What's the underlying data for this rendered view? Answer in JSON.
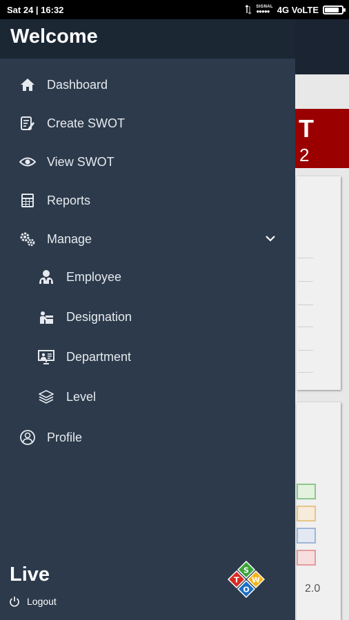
{
  "status_bar": {
    "time": "Sat 24 | 16:32",
    "signal_label": "SIGNAL",
    "network": "4G VoLTE",
    "battery_level": 0.85
  },
  "drawer": {
    "header_title": "Welcome",
    "menu": [
      {
        "label": "Dashboard",
        "icon": "home-icon"
      },
      {
        "label": "Create SWOT",
        "icon": "edit-document-icon"
      },
      {
        "label": "View SWOT",
        "icon": "eye-icon"
      },
      {
        "label": "Reports",
        "icon": "calculator-icon"
      },
      {
        "label": "Manage",
        "icon": "gears-icon",
        "expanded": true
      }
    ],
    "submenu": [
      {
        "label": "Employee",
        "icon": "users-icon"
      },
      {
        "label": "Designation",
        "icon": "worker-desk-icon"
      },
      {
        "label": "Department",
        "icon": "presentation-board-icon"
      },
      {
        "label": "Level",
        "icon": "layers-icon"
      }
    ],
    "profile_label": "Profile",
    "footer": {
      "status": "Live",
      "logout_label": "Logout",
      "logo_letters": [
        "S",
        "W",
        "O",
        "T"
      ]
    }
  },
  "background_app": {
    "letter": "T",
    "number": "2",
    "axis_value": "2.0"
  },
  "colors": {
    "drawer_bg": "#2c3a4b",
    "drawer_header_bg": "#1c2734",
    "accent_red": "#9b0000",
    "logo_green": "#3aa53a",
    "logo_yellow": "#f2b418",
    "logo_blue": "#1f6fc4",
    "logo_red": "#d82b22"
  }
}
